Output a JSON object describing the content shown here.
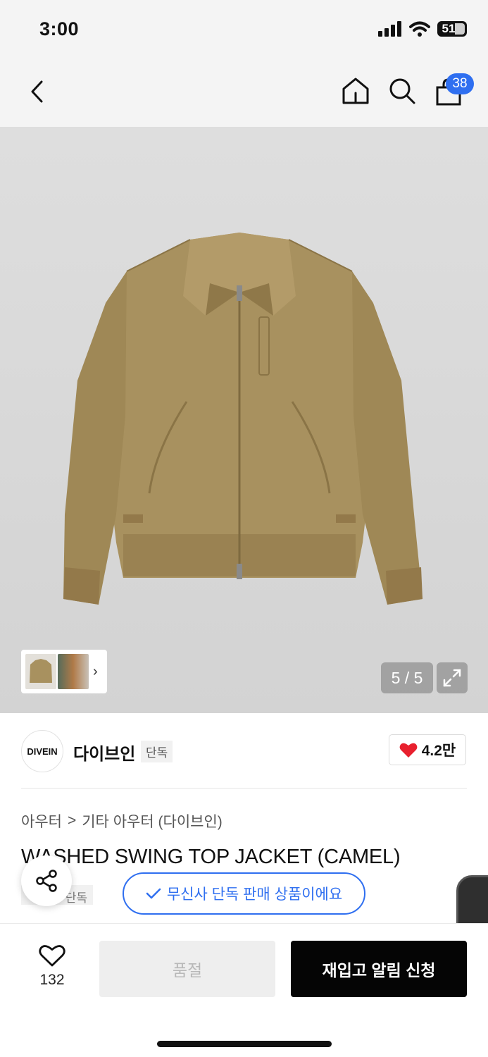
{
  "status_bar": {
    "time": "3:00",
    "battery": "51"
  },
  "nav": {
    "cart_count": "38"
  },
  "gallery": {
    "counter": "5 / 5"
  },
  "brand": {
    "logo_text": "DIVEIN",
    "name": "다이브인",
    "tag": "단독",
    "like_count": "4.2만"
  },
  "breadcrumb": {
    "level1": "아우터",
    "separator": ">",
    "level2": "기타 아우터 (다이브인)"
  },
  "product": {
    "title": "WASHED SWING TOP JACKET (CAMEL)",
    "exclusive_tag": "단독",
    "exclusive_notice": "무신사 단독 판매 상품이에요"
  },
  "actions": {
    "wish_count": "132",
    "soldout_label": "품절",
    "restock_label": "재입고 알림 신청"
  },
  "colors": {
    "accent": "#2f6ff0",
    "heart": "#e8202e",
    "jacket": "#a8915f",
    "cta": "#050505"
  }
}
